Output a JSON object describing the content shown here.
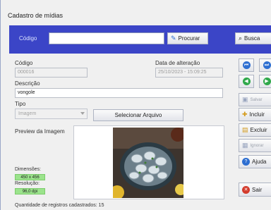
{
  "window": {
    "title": "Cadastro de mídias"
  },
  "search": {
    "label": "Código",
    "value": "",
    "procurar_label": "Procurar",
    "busca_label": "Busca"
  },
  "form": {
    "codigo_label": "Código",
    "codigo_value": "000016",
    "data_label": "Data de alteração",
    "data_value": "25/10/2023 - 15:09:25",
    "descricao_label": "Descrição",
    "descricao_value": "vongole",
    "tipo_label": "Tipo",
    "tipo_value": "Imagem",
    "selecionar_label": "Selecionar Arquivo",
    "preview_label": "Preview da Imagem",
    "dimensoes_label": "Dimensões:",
    "dimensoes_value": "450 x 456",
    "resolucao_label": "Resolução:",
    "resolucao_value": "96,0 dpi"
  },
  "side": {
    "salvar_label": "Salvar",
    "incluir_label": "Incluir",
    "excluir_label": "Excluir",
    "ignorar_label": "Ignorar",
    "ajuda_label": "Ajuda",
    "sair_label": "Sair"
  },
  "status": {
    "text": "Quantidade de registros cadastrados:  15"
  },
  "colors": {
    "header": "#3b45c7",
    "badge": "#9be38c",
    "nav_blue": "#2e6fd1",
    "nav_green": "#2fa84a",
    "exit_red": "#d33b2c"
  }
}
